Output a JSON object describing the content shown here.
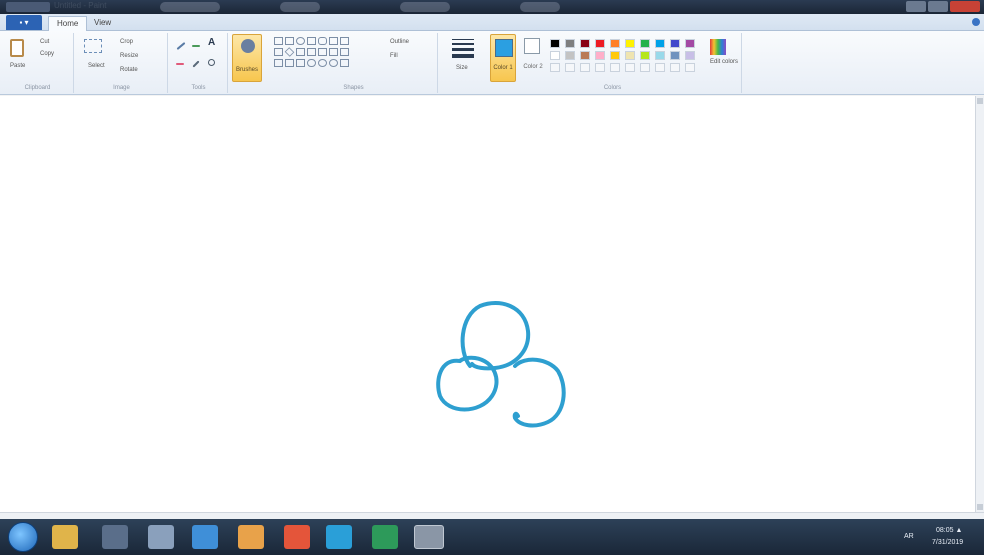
{
  "window": {
    "title": "Untitled - Paint"
  },
  "ribbon_tabs": [
    "Home",
    "View"
  ],
  "file_tab_label": "▪ ▾",
  "clipboard": {
    "paste": "Paste",
    "cut": "Cut",
    "copy": "Copy",
    "group": "Clipboard"
  },
  "image": {
    "select": "Select",
    "crop": "Crop",
    "resize": "Resize",
    "rotate": "Rotate",
    "group": "Image"
  },
  "tools": {
    "group": "Tools",
    "text_tool": "A"
  },
  "brushes": {
    "label": "Brushes"
  },
  "shapes": {
    "group": "Shapes",
    "outline": "Outline",
    "fill": "Fill"
  },
  "size": {
    "label": "Size"
  },
  "colors": {
    "color1_label": "Color 1",
    "color2_label": "Color 2",
    "edit_colors": "Edit colors",
    "group": "Colors",
    "active_color": "#2b9fe1",
    "palette_row1": [
      "#000000",
      "#7f7f7f",
      "#880015",
      "#ed1c24",
      "#ff7f27",
      "#fff200",
      "#22b14c",
      "#00a2e8",
      "#3f48cc",
      "#a349a4"
    ],
    "palette_row2": [
      "#ffffff",
      "#c3c3c3",
      "#b97a57",
      "#ffaec9",
      "#ffc90e",
      "#efe4b0",
      "#b5e61d",
      "#99d9ea",
      "#7092be",
      "#c8bfe7"
    ]
  },
  "taskbar": {
    "language": "AR",
    "time": "08:05 ▲",
    "date": "7/31/2019"
  }
}
